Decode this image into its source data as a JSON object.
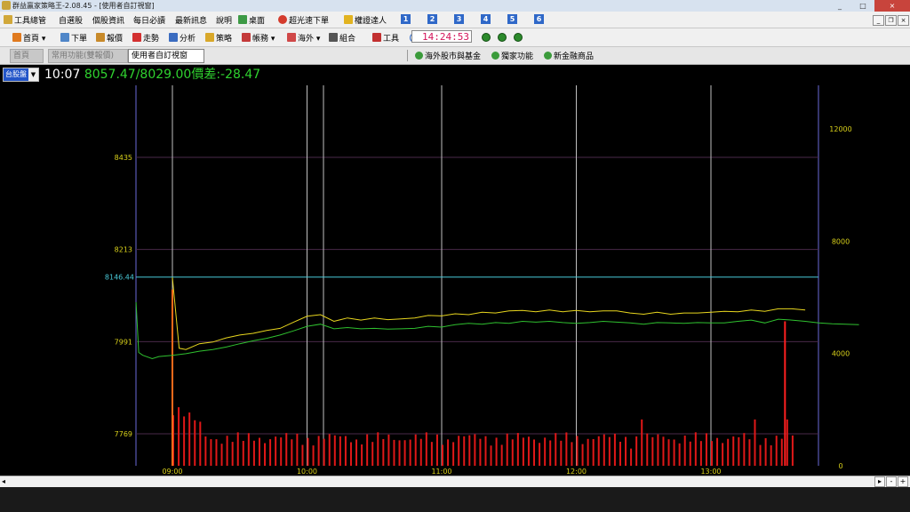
{
  "window": {
    "title": "群益贏家策略王-2.08.45 - [使用者自訂視窗]",
    "min": "_",
    "max": "□",
    "close": "×"
  },
  "menu": {
    "items": [
      "工具總管",
      "自選股",
      "個股資訊",
      "每日必讀",
      "最新訊息",
      "說明",
      "桌面",
      "超光速下單",
      "權證達人"
    ],
    "nums": [
      "1",
      "2",
      "3",
      "4",
      "5",
      "6"
    ],
    "mdi": [
      "_",
      "❐",
      "×"
    ]
  },
  "toolbar": {
    "items": [
      "首頁",
      "下單",
      "報價",
      "走勢",
      "分析",
      "策略",
      "帳務",
      "海外",
      "組合",
      "工具"
    ],
    "clock": "14:24:53"
  },
  "tabs": [
    "首頁",
    "常用功能(雙報價)",
    "使用者自訂視窗"
  ],
  "quick_links": [
    "海外股市與基金",
    "獨家功能",
    "新金融商品"
  ],
  "market_select": {
    "value": "台股盤"
  },
  "headline": {
    "time": "10:07",
    "values": "8057.47/8029.00",
    "spread": "價差:-28.47"
  },
  "chart_data": {
    "type": "line",
    "x_ticks": [
      "09:00",
      "10:00",
      "11:00",
      "12:00",
      "13:00"
    ],
    "y_left_ticks": [
      7769,
      7991,
      8213,
      8435
    ],
    "y_right_ticks": [
      0,
      4000,
      8000,
      12000
    ],
    "reference": {
      "value": 8146.44,
      "label": "8146.44",
      "color": "#49c9d8"
    },
    "ylim": [
      7710,
      8520
    ],
    "volume_ylim": [
      0,
      12000
    ],
    "series": [
      {
        "color": "#e8d61e",
        "x": [
          0.0,
          0.05,
          0.1,
          0.2,
          0.3,
          0.4,
          0.5,
          0.6,
          0.7,
          0.8,
          0.9,
          1.0,
          1.1,
          1.2,
          1.3,
          1.4,
          1.5,
          1.6,
          1.7,
          1.8,
          1.9,
          2.0,
          2.1,
          2.2,
          2.3,
          2.4,
          2.5,
          2.6,
          2.7,
          2.8,
          2.9,
          3.0,
          3.1,
          3.2,
          3.3,
          3.4,
          3.5,
          3.6,
          3.7,
          3.8,
          3.9,
          4.0,
          4.1,
          4.2,
          4.3,
          4.4,
          4.5,
          4.6,
          4.7
        ],
        "values": [
          8146,
          7975,
          7972,
          7986,
          7990,
          8000,
          8007,
          8011,
          8018,
          8023,
          8038,
          8052,
          8056,
          8040,
          8048,
          8043,
          8048,
          8044,
          8046,
          8048,
          8054,
          8053,
          8058,
          8056,
          8062,
          8060,
          8065,
          8066,
          8063,
          8067,
          8063,
          8066,
          8063,
          8065,
          8065,
          8060,
          8057,
          8062,
          8057,
          8060,
          8060,
          8062,
          8064,
          8063,
          8067,
          8064,
          8070,
          8070,
          8067
        ]
      },
      {
        "color": "#2fc02f",
        "x": [
          -0.27,
          -0.25,
          -0.22,
          -0.15,
          -0.1,
          0.0,
          0.1,
          0.2,
          0.3,
          0.4,
          0.5,
          0.6,
          0.7,
          0.8,
          0.9,
          1.0,
          1.1,
          1.2,
          1.3,
          1.4,
          1.5,
          1.6,
          1.7,
          1.8,
          1.9,
          2.0,
          2.1,
          2.2,
          2.3,
          2.4,
          2.5,
          2.6,
          2.7,
          2.8,
          2.9,
          3.0,
          3.1,
          3.2,
          3.3,
          3.4,
          3.5,
          3.6,
          3.7,
          3.8,
          3.9,
          4.0,
          4.1,
          4.2,
          4.3,
          4.4,
          4.5,
          4.6,
          4.7,
          4.8,
          4.9,
          5.0,
          5.1
        ],
        "values": [
          8086,
          7965,
          7958,
          7950,
          7955,
          7958,
          7962,
          7968,
          7972,
          7978,
          7986,
          7993,
          7999,
          8007,
          8017,
          8028,
          8033,
          8022,
          8025,
          8022,
          8023,
          8021,
          8022,
          8023,
          8028,
          8026,
          8032,
          8035,
          8033,
          8037,
          8035,
          8040,
          8038,
          8040,
          8037,
          8035,
          8037,
          8040,
          8038,
          8036,
          8033,
          8037,
          8036,
          8035,
          8037,
          8036,
          8036,
          8040,
          8043,
          8036,
          8045,
          8043,
          8040,
          8036,
          8034,
          8033,
          8032
        ]
      }
    ]
  }
}
